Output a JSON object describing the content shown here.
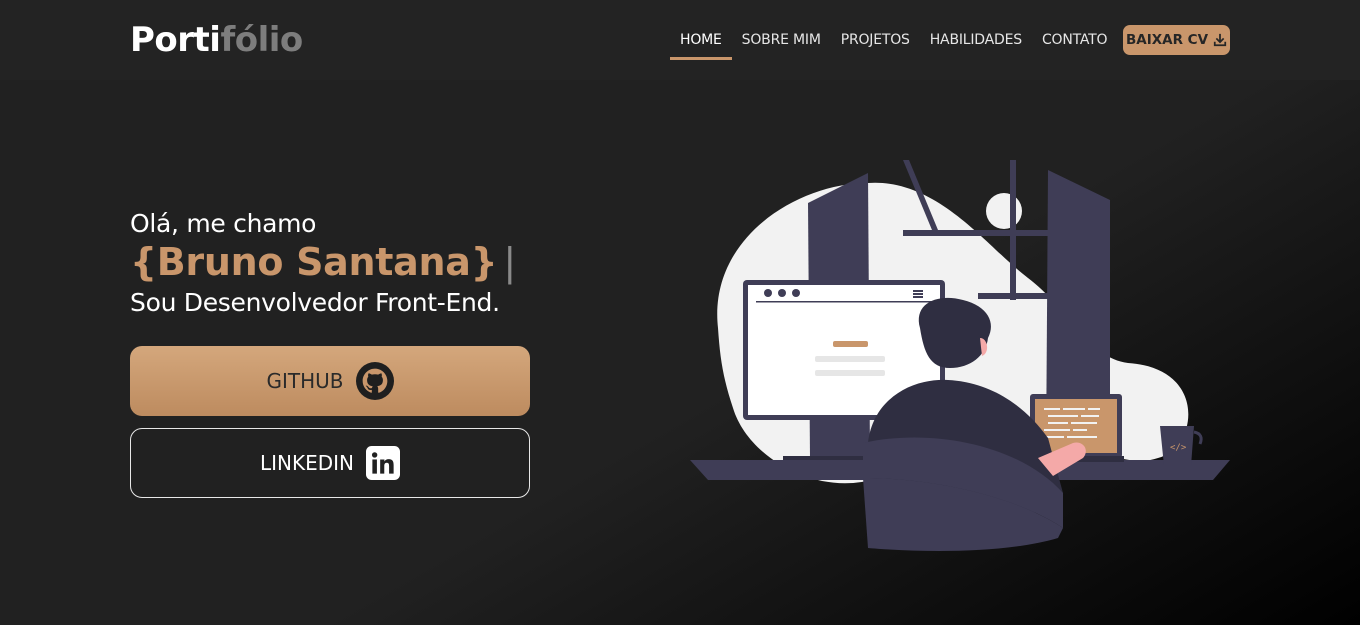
{
  "header": {
    "logo_part1": "Porti",
    "logo_part2": "fólio",
    "nav": [
      "HOME",
      "SOBRE MIM",
      "PROJETOS",
      "HABILIDADES",
      "CONTATO"
    ],
    "active_nav": "HOME",
    "cv_label": "BAIXAR CV"
  },
  "hero": {
    "greeting": "Olá, me chamo",
    "name": "{Bruno Santana}",
    "cursor": "|",
    "role": "Sou Desenvolvedor Front-End.",
    "github_label": "GITHUB",
    "linkedin_label": "LINKEDIN"
  },
  "colors": {
    "accent": "#c9966b",
    "background": "#212121",
    "header_bg": "#232323"
  },
  "icons": {
    "download": "download-icon",
    "github": "github-icon",
    "linkedin": "linkedin-icon"
  }
}
